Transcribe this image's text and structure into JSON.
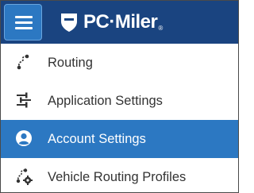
{
  "header": {
    "menu_button_icon": "hamburger-menu-icon",
    "logo": {
      "icon": "shield-logo-icon",
      "brand": "PC·Miler",
      "registered": "®"
    }
  },
  "menu": {
    "items": [
      {
        "label": "Routing",
        "icon": "route-path-icon",
        "active": false
      },
      {
        "label": "Application Settings",
        "icon": "sliders-icon",
        "active": false
      },
      {
        "label": "Account Settings",
        "icon": "user-circle-icon",
        "active": true
      },
      {
        "label": "Vehicle Routing Profiles",
        "icon": "route-gear-icon",
        "active": false
      }
    ]
  },
  "colors": {
    "header_bg": "#1a4480",
    "accent": "#2c78c2",
    "text": "#333333",
    "active_text": "#ffffff"
  }
}
